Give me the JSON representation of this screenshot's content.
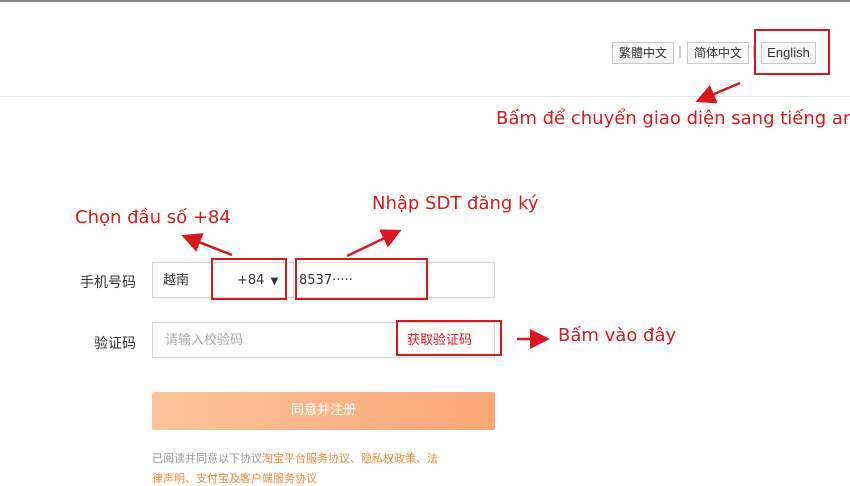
{
  "header": {
    "lang_traditional": "繁體中文",
    "lang_simplified": "简体中文",
    "lang_english": "English",
    "separator": "|"
  },
  "annotations": {
    "switch_english": "Bấm để chuyển giao diện sang tiếng anh",
    "choose_code": "Chọn đầu số +84",
    "enter_phone": "Nhập SDT đăng ký",
    "click_here": "Bấm vào đây"
  },
  "form": {
    "phone_label": "手机号码",
    "country_name": "越南",
    "country_code": "+84",
    "phone_value": "8537·····",
    "code_label": "验证码",
    "code_placeholder": "请输入校验码",
    "get_code_button": "获取验证码",
    "submit_button": "同意并注册",
    "agreement_prefix": "已阅读并同意以下协议",
    "agreement_links": "淘宝平台服务协议、隐私权政策、法",
    "agreement_line2": "律声明、支付宝及客户端服务协议"
  },
  "colors": {
    "annotation_red": "#d8171f",
    "submit_gradient_start": "#fbc49a",
    "submit_gradient_end": "#fba677",
    "link_orange": "#f08a3a"
  }
}
